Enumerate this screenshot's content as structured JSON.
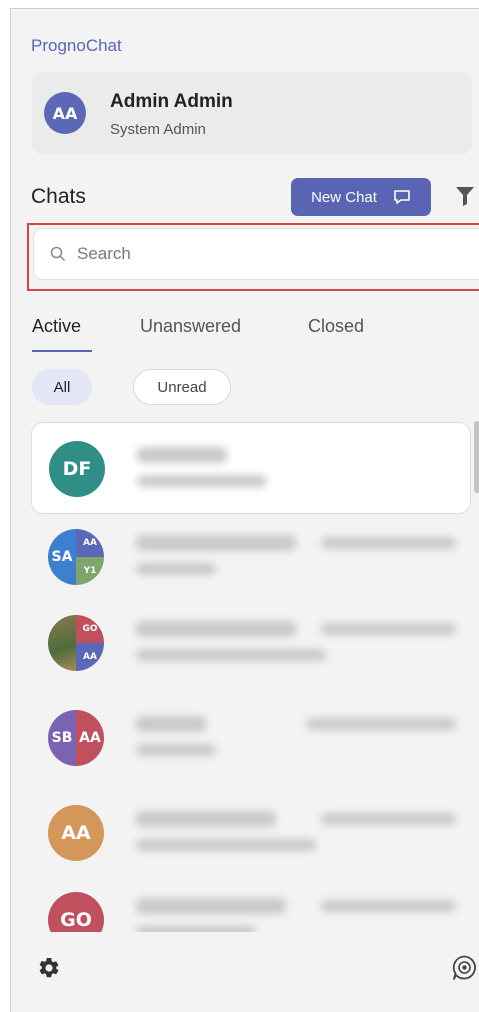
{
  "app": {
    "brand": "PrognoChat"
  },
  "user": {
    "initials": "AA",
    "name": "Admin Admin",
    "role": "System Admin",
    "avatar_color": "#5b67b7"
  },
  "chats_header": {
    "title": "Chats",
    "new_chat_label": "New Chat",
    "new_chat_icon": "chat-bubble-icon",
    "filter_icon": "filter-icon"
  },
  "search": {
    "placeholder": "Search",
    "value": "",
    "icon": "search-icon"
  },
  "tabs": [
    {
      "label": "Active",
      "selected": true
    },
    {
      "label": "Unanswered",
      "selected": false
    },
    {
      "label": "Closed",
      "selected": false
    }
  ],
  "filters": [
    {
      "label": "All",
      "selected": true
    },
    {
      "label": "Unread",
      "selected": false
    }
  ],
  "chats": [
    {
      "avatar_type": "single",
      "initials": "DF",
      "color": "#2f8f87",
      "selected": true
    },
    {
      "avatar_type": "group",
      "initials": [
        "SA",
        "AA",
        "Y1"
      ],
      "colors": [
        "#3f7fd0",
        "#5b67b7",
        "#7da56d"
      ]
    },
    {
      "avatar_type": "photo",
      "initials": [
        "GO",
        "AA"
      ],
      "colors": [
        "#c0505e",
        "#5b67b7"
      ]
    },
    {
      "avatar_type": "split",
      "initials": [
        "SB",
        "AA"
      ],
      "colors": [
        "#7a63b2",
        "#c0505e"
      ]
    },
    {
      "avatar_type": "single",
      "initials": "AA",
      "color": "#d4975a"
    },
    {
      "avatar_type": "single",
      "initials": "GO",
      "color": "#c0505e"
    }
  ],
  "footer": {
    "settings_icon": "gear-icon",
    "support_icon": "chat-support-icon"
  },
  "colors": {
    "accent": "#5964b3",
    "highlight_outline": "#d64541",
    "background": "#f3f3f3"
  }
}
